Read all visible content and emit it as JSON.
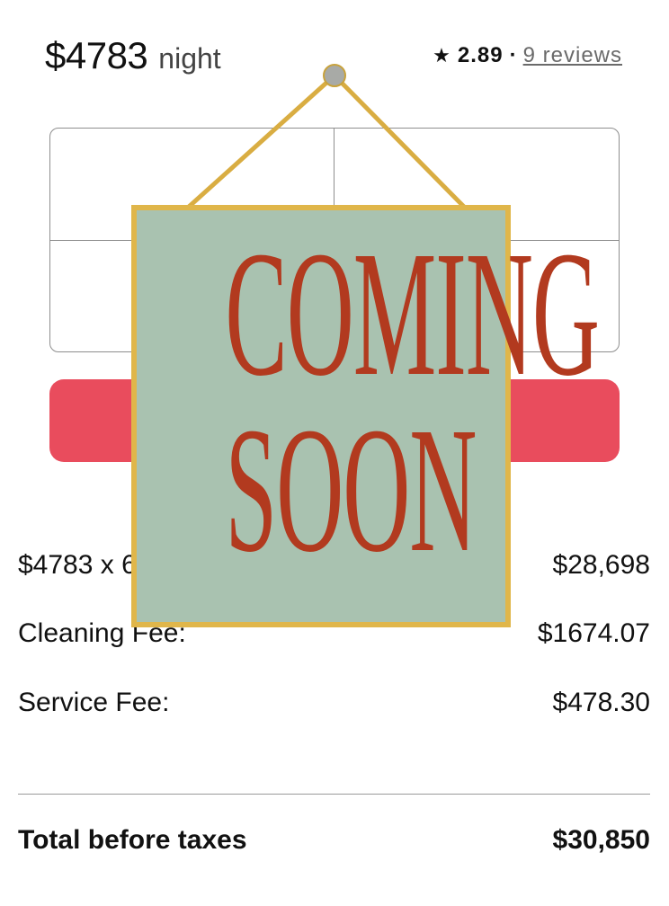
{
  "header": {
    "price": "$4783",
    "price_unit": "night",
    "rating": "2.89",
    "separator": "·",
    "reviews_link": "9 reviews"
  },
  "reserve": {
    "label": ""
  },
  "fees": {
    "nights_label": "$4783 x 6 nights",
    "nights_value": "$28,698",
    "cleaning_label": "Cleaning Fee:",
    "cleaning_value": "$1674.07",
    "service_label": "Service Fee:",
    "service_value": "$478.30"
  },
  "total": {
    "label": "Total before taxes",
    "value": "$30,850"
  },
  "overlay": {
    "line1": "COMING",
    "line2": "SOON"
  },
  "icons": {
    "rating": "star-icon"
  },
  "colors": {
    "accent": "#e94c5d",
    "sign_bg": "#a9c2b0",
    "sign_text": "#b23a1f",
    "sign_frame": "#e0b64a"
  }
}
